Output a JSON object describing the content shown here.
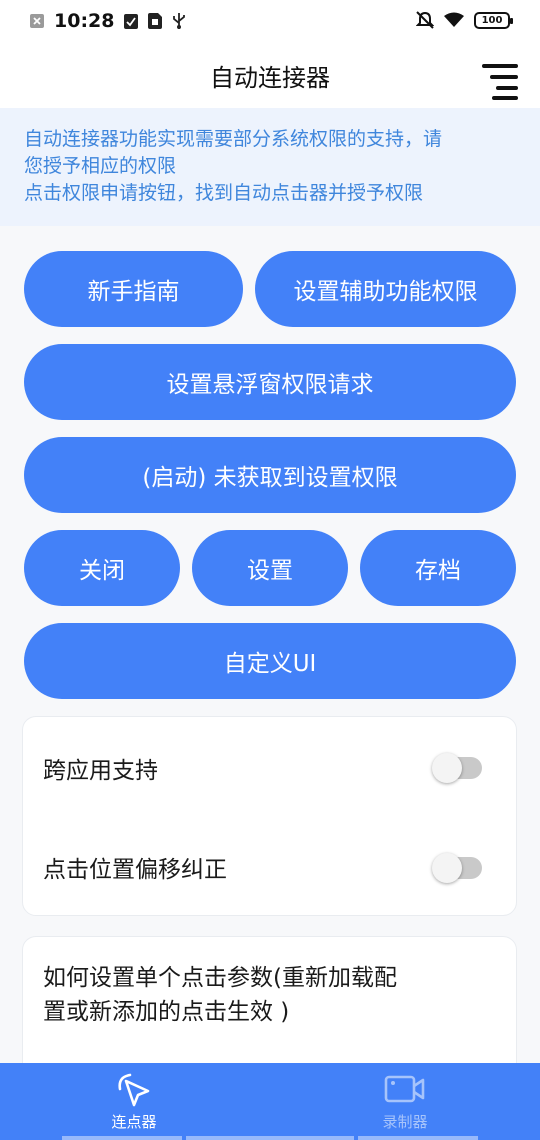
{
  "status_bar": {
    "time": "10:28",
    "battery": "100",
    "icons": [
      "close-box-icon",
      "check-doc-icon",
      "sim-icon",
      "usb-icon",
      "bell-off-icon",
      "wifi-icon",
      "battery-icon"
    ]
  },
  "header": {
    "title": "自动连接器",
    "menu_icon": "menu-icon"
  },
  "notice": {
    "lines": [
      "自动连接器功能实现需要部分系统权限的支持，请",
      "您授予相应的权限",
      "点击权限申请按钮，找到自动点击器并授予权限"
    ]
  },
  "buttons": {
    "guide": "新手指南",
    "accessibility": "设置辅助功能权限",
    "float_window": "设置悬浮窗权限请求",
    "start": "(启动) 未获取到设置权限",
    "close": "关闭",
    "settings": "设置",
    "archive": "存档",
    "custom_ui": "自定义UI"
  },
  "toggles": [
    {
      "label": "跨应用支持",
      "on": false
    },
    {
      "label": "点击位置偏移纠正",
      "on": false
    }
  ],
  "info_card": {
    "lines": [
      "如何设置单个点击参数(重新加载配",
      "置或新添加的点击生效 )"
    ]
  },
  "bottom_nav": {
    "tabs": [
      {
        "label": "连点器",
        "icon": "cursor-click-icon",
        "active": true
      },
      {
        "label": "录制器",
        "icon": "video-camera-icon",
        "active": false
      }
    ]
  },
  "colors": {
    "primary": "#4381f8",
    "notice_bg": "#edf3fd",
    "notice_text": "#3f86dc",
    "page_bg": "#f7f8fa"
  }
}
